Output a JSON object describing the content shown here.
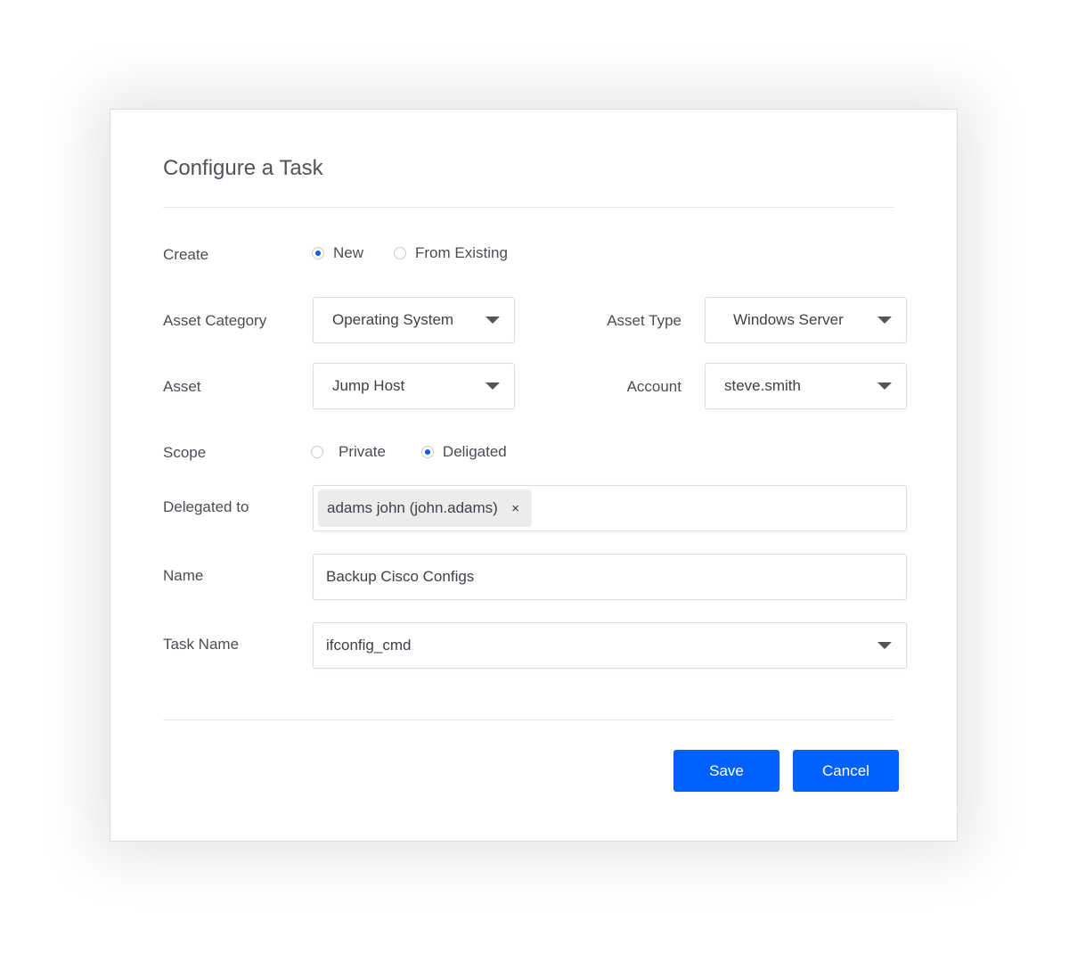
{
  "dialog": {
    "title": "Configure a Task",
    "create": {
      "label": "Create",
      "options": [
        {
          "label": "New",
          "checked": true
        },
        {
          "label": "From Existing",
          "checked": false
        }
      ]
    },
    "asset_category": {
      "label": "Asset Category",
      "value": "Operating System"
    },
    "asset_type": {
      "label": "Asset Type",
      "value": "Windows Server"
    },
    "asset": {
      "label": "Asset",
      "value": "Jump Host"
    },
    "account": {
      "label": "Account",
      "value": "steve.smith"
    },
    "scope": {
      "label": "Scope",
      "options": [
        {
          "label": "Private",
          "checked": false
        },
        {
          "label": "Deligated",
          "checked": true
        }
      ]
    },
    "delegated_to": {
      "label": "Delegated to",
      "chips": [
        "adams john (john.adams)"
      ],
      "remove_glyph": "×"
    },
    "name": {
      "label": "Name",
      "value": "Backup Cisco Configs"
    },
    "task_name": {
      "label": "Task Name",
      "value": "ifconfig_cmd"
    },
    "buttons": {
      "save": "Save",
      "cancel": "Cancel"
    }
  },
  "colors": {
    "accent": "#0061ff",
    "radio_selected": "#0b5cf2",
    "chip_background": "#ececec",
    "title_text": "#505459",
    "label_text": "#4a4e54"
  },
  "icons": {
    "dropdown": "caret-down-icon",
    "remove_chip": "close-icon"
  }
}
